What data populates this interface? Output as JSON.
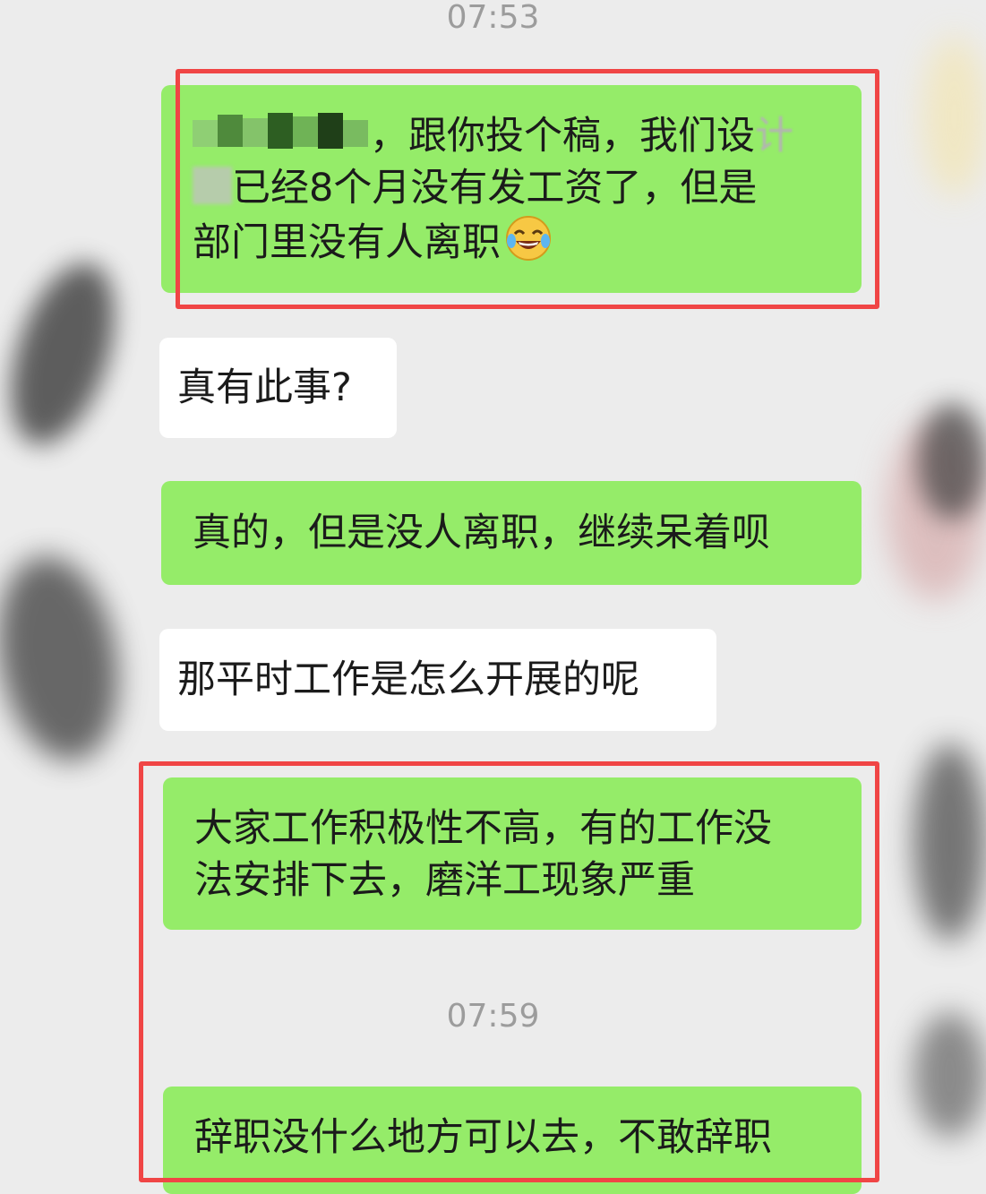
{
  "timestamps": {
    "first": "07:53",
    "second": "07:59"
  },
  "messages": [
    {
      "side": "right",
      "lines": [
        {
          "visible": "，跟你投个稿，我们设",
          "faded": "计"
        },
        {
          "visible": "已经8个月没有发工资了，但是"
        },
        {
          "visible": "部门里没有人离职",
          "emoji": "laughing-with-tears-emoji"
        }
      ]
    },
    {
      "side": "left",
      "text": "真有此事?"
    },
    {
      "side": "right",
      "text": "真的，但是没人离职，继续呆着呗"
    },
    {
      "side": "left",
      "text": "那平时工作是怎么开展的呢"
    },
    {
      "side": "right",
      "lines": [
        "大家工作积极性不高，有的工作没",
        "法安排下去，磨洋工现象严重"
      ]
    },
    {
      "side": "right",
      "text": "辞职没什么地方可以去，不敢辞职"
    }
  ],
  "colors": {
    "background": "#ececec",
    "bubble_sent": "#95ec69",
    "bubble_received": "#ffffff",
    "highlight_box": "#f04545",
    "timestamp_text": "#9c9c9c"
  },
  "icons": [
    "pixelated-mosaic",
    "laughing-with-tears-emoji"
  ]
}
